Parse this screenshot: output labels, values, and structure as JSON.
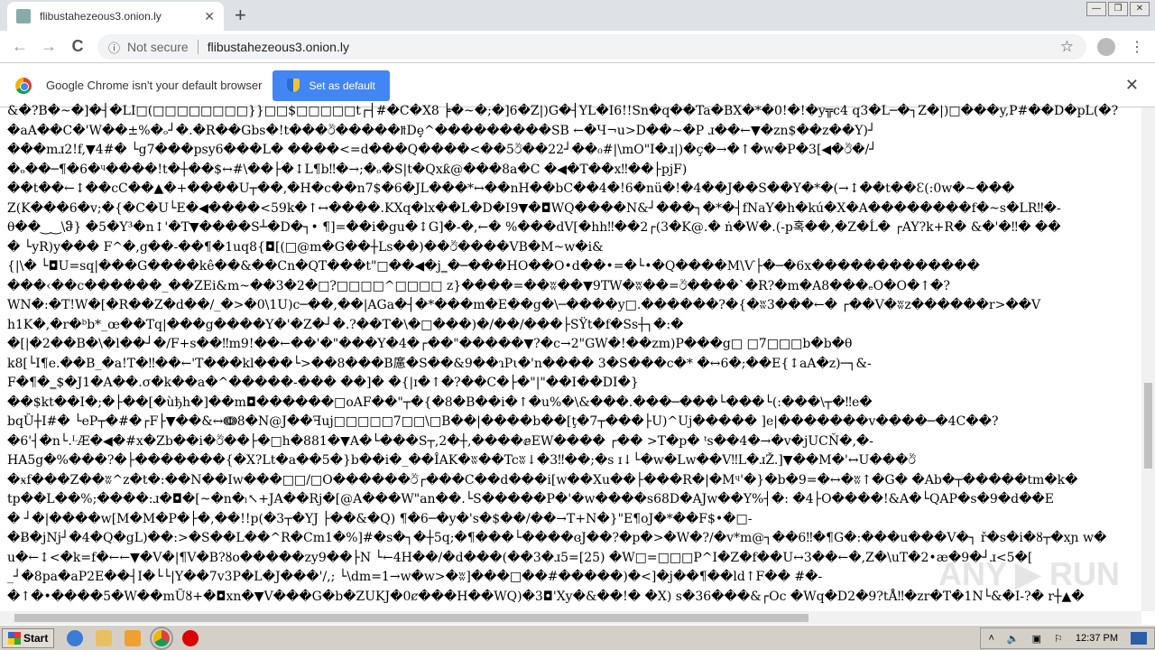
{
  "tab": {
    "title": "flibustahezeous3.onion.ly",
    "close": "✕",
    "new": "+"
  },
  "window": {
    "min": "—",
    "restore": "❐",
    "close": "✕"
  },
  "toolbar": {
    "back": "←",
    "forward": "→",
    "reload": "C",
    "not_secure": "Not secure",
    "url": "flibustahezeous3.onion.ly",
    "star": "☆",
    "menu": "⋮"
  },
  "infobar": {
    "message": "Google Chrome isn't your default browser",
    "button": "Set as default",
    "close": "✕"
  },
  "content_lines": [
    "&�?B�~�]�┤�LI□(□□□□□□□□}}□□$□□□□□t┌┤#�C�X8 ╞�~�;�]6�Z|)G�┤YL�I6!!Sn�q��Ta�BX�*�0!�!�y╦c4 q3�L─�┐Z�|)□���y,P#��D�pL(�?",
    "�aA��C�'W��±%�ₒ┘�.�R��Gbs�!t���ඊ�����₶Dȩ^���������SB ←�Ч¬u>D��~�P ɹ��←▼�zn$��z��Y)┘",
    "���mɹ2!f,▼4#� └g7���psy6���L� ����<=d���Q����<��5ඊ��22┘��₀#|\\mO\"I�ɹ|)�ç�→�↑�w�P�3[◀�ඊ�/┘",
    "�ₒ��─¶�6�ᶣ����!t�┼��$↔#\\��├�↕L¶b‼�→;�ₒ�S|t�Qxƙ@���8a�C �◀�T��x‼��├pjF)",
    "��t��←↕��cC��▲�+����U┬��,�H�c��n7$�6�JL���*↔��nH��bC��4�!6�nü�!�4��J��S��Y�*�(→↕��t��Ɛ(:0w�~���",
    "Z(K���6�v;�{�C�U└E�◀����<59k�↑↔����.KXq�lx��L�D�I9▼�◘WQ����N&┘���┐�*�┤fNaY�h�kú�X�A��������f�~s�LR‼�-",
    "θ��‿‿\\ჵ} �5�Y³�n↕'�T▼����S┴�D�┐• ¶]=��i�gu�↕G]�-�,←� %���dV[�hh‼��2┌(3�K@.� ṅ�W�.(-p혹��,�Z�Ĺ� ┌AY?k+R� &�'�‼� ��",
    "� └yR)y��� F^�,g��-��¶�1uq8{◘[(□@m�G��┼Ls��)��ඊ����VB�M~w�i&",
    "{|\\� └◘U=sq|���G����kê��&��Cn�QT���t\"□��◀�j‗�─���HO��O•d��•=�└•�Q����M\\Ѵ├�─�6x�������������",
    "���‹��c������_��ZEi&m~��3�2�□?□□□□^□□□□ z}����=��ʬ��▼9TW�ʬ��=ඊ����`�R?�m�A8���ₑO�O�↑�?",
    "WN�:�T!W�[�R��Z�d��/_�>�0\\1U)c─��,��|AGa�┤�*���m�E��g�\\─����y□.������?�{�ʬ3���←� ┌��V�ʬz������r>��V",
    "h1K�,�r�ᵇb*_œ��Tq|���g����Y�'�Z�┘�.?��T�\\�□���)�/��/���├SŸt�f�Ss┼┐�:�",
    "�[|�2��B�\\�l��┘�/F+s��‼m9!��←��'�\"���Y�4�┌��\"�����▼?�c→2\"GW�!��zm)P���g□ □7□□□b�b�θ",
    "k8[└I¶e.��B_�a!T�‼��←'T���kl���└>��8���B㢜�S��&9��ɿPι�'n���� 3�S���c�*  �↔6�;��E{↕aA�z)─┐&-",
    "F�¶�‗$�J1�A��.σ�k��a�^�����-��� ��]� �{|ɪ�↑�?��C�├�\"|\"��I��DI�}",
    "��$kt��I�;�├��[�ùђh�]��m◘������□oAF��\"┬�{�8�B��i�↑�u%�\\&���.���─���└���└(:���\\┬�‼e�",
    "bqȔ┼I#� └eP┬�#�┌F├▼��&↔ↈ8�N@J��ꟻuj□□□□□7□□\\□B��|����b��[ţ�7┬���├U)^Uj����� ]e|�������v����─�4C��?",
    "�6'┤�n└.ᴸÆ�◀�#x�Zb��i�ඊ��├�□h�881�▼A�└���S┬,2�┼,����ⅇEW���� ┌�� >T�p� ᵗs��4�→�v�jUCŇ�,�-",
    "HA5g�%���?�├�������{�X?Lt�a��5�}b��i�_��ÎAK�ʬ��Tcʬ↓�3‼��;�s ɪ↓└�w�Lw��V‼L�ɹŽ.]▼��M�'↔U���ඊ",
    "�ӿf���Z��ʬ^z�t�:��N��Iw���□□/□O������ඊ┌���C��d���i[w��Xu��├���R�|�Mᶣ'�}�b�9=�↔�ʬ↑�G� �Ab�┬�����tm�k�",
    "tp��L��%;����:ɹ�◘�[~�n�ₗ↖+JA��Rj�[@A���W\"an��.└S�����P�'�w����s68D�AJw��Y%┤�: �4├O����!&A�└QAP�s�9�d��E",
    "� ┘�|����w[M�M�P�├�,��!!p(�3┬�YJ ├��&�Q) ¶�6─�y�'s�$��/��→T+N�}\"E¶oJ�*��F$•�□-",
    "�Ƀ�jNj┘�4�Q�gL)��:>�S��L��^R�Cm1�%]#�s�┐�┼5q;�¶���└����ɞJ��?�p�>�W�?/�v*m@┐��6‼�¶G�:���u���V�┐ ř�s�i�ȣ┬�xɲ w�",
    "u�←↕<�k=f�←←▼�V�|¶V�B?ȣo�����zy9��├N └←4H��/�d���(��3�ɹ5=[25) �W□=□□□P^I�Z�f��U↔3��←�,Z�\\uT�2•æ�9�┘ɹ<5�[",
    "_┘�8pa�aP2E��┤I�└└|Y��7v3P�L�J���'/,; └\\dm=1→w�w>�ʬ]���□��#�����)�<]�j��¶��ld↑F�� #�-",
    "�↑�•����5�W��mŨȣ+�◘xn�▼V���G�b�ZUKJ�0ȼ���H��WQ)�3◘'Xy�&��!� �X) s�36���&┌Oc �Wq�D2�9?tÅ‼�zr�T�1N└&�I-?� r┼▲�"
  ],
  "watermark": "ANY RUN",
  "taskbar": {
    "start": "Start",
    "clock": "12:37 PM"
  },
  "colors": {
    "accent": "#4285f4",
    "tabstrip": "#dee1e6",
    "taskbar": "#d4d0c8"
  }
}
